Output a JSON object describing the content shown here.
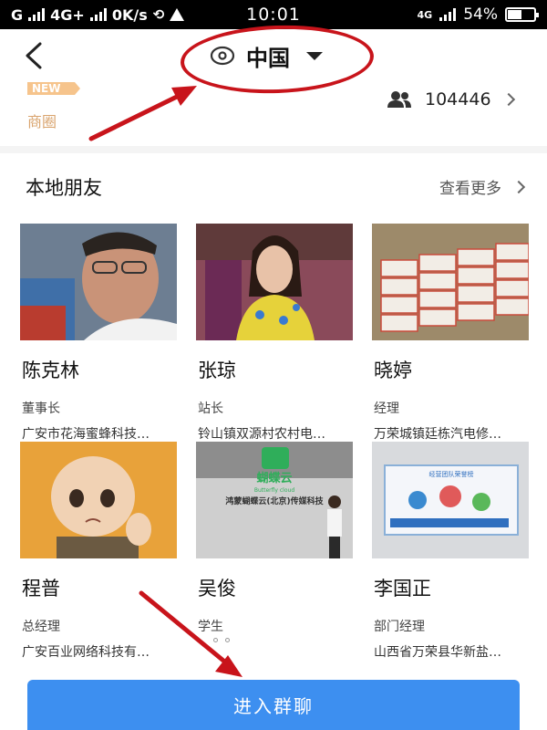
{
  "status_bar": {
    "carrier": "G",
    "network": "4G+",
    "speed": "0K/s",
    "time": "10:01",
    "network_right": "4G",
    "battery": "54%",
    "battery_level": 0.54
  },
  "header": {
    "location_name": "中国",
    "icons": [
      "back-arrow-icon",
      "location-pin-icon",
      "caret-down-icon"
    ]
  },
  "business": {
    "badge": "NEW",
    "label": "商圈",
    "member_count": "104446",
    "icons": [
      "people-icon",
      "chevron-right-icon"
    ]
  },
  "section": {
    "title": "本地朋友",
    "more_label": "查看更多"
  },
  "friends": [
    {
      "name": "陈克林",
      "role": "董事长",
      "company": "广安市花海蜜蜂科技…"
    },
    {
      "name": "张琼",
      "role": "站长",
      "company": "铃山镇双源村农村电…"
    },
    {
      "name": "晓婷",
      "role": "经理",
      "company": "万荣城镇廷栋汽电修…"
    },
    {
      "name": "程普",
      "role": "总经理",
      "company": "广安百业网络科技有…"
    },
    {
      "name": "吴俊",
      "role": "学生",
      "company": ""
    },
    {
      "name": "李国正",
      "role": "部门经理",
      "company": "山西省万荣县华新盐…"
    }
  ],
  "photo_texts": {
    "sign_title": "蝴蝶云",
    "sign_sub": "Butterfly cloud",
    "sign_banner": "鸿蒙蝴蝶云(北京)传媒科技",
    "poster_title": "经营团队荣誉榜"
  },
  "join_button": {
    "label": "进入群聊"
  },
  "colors": {
    "accent_button": "#3d8ff0",
    "annotation_red": "#c8141b",
    "badge_orange": "#f6c48c"
  }
}
